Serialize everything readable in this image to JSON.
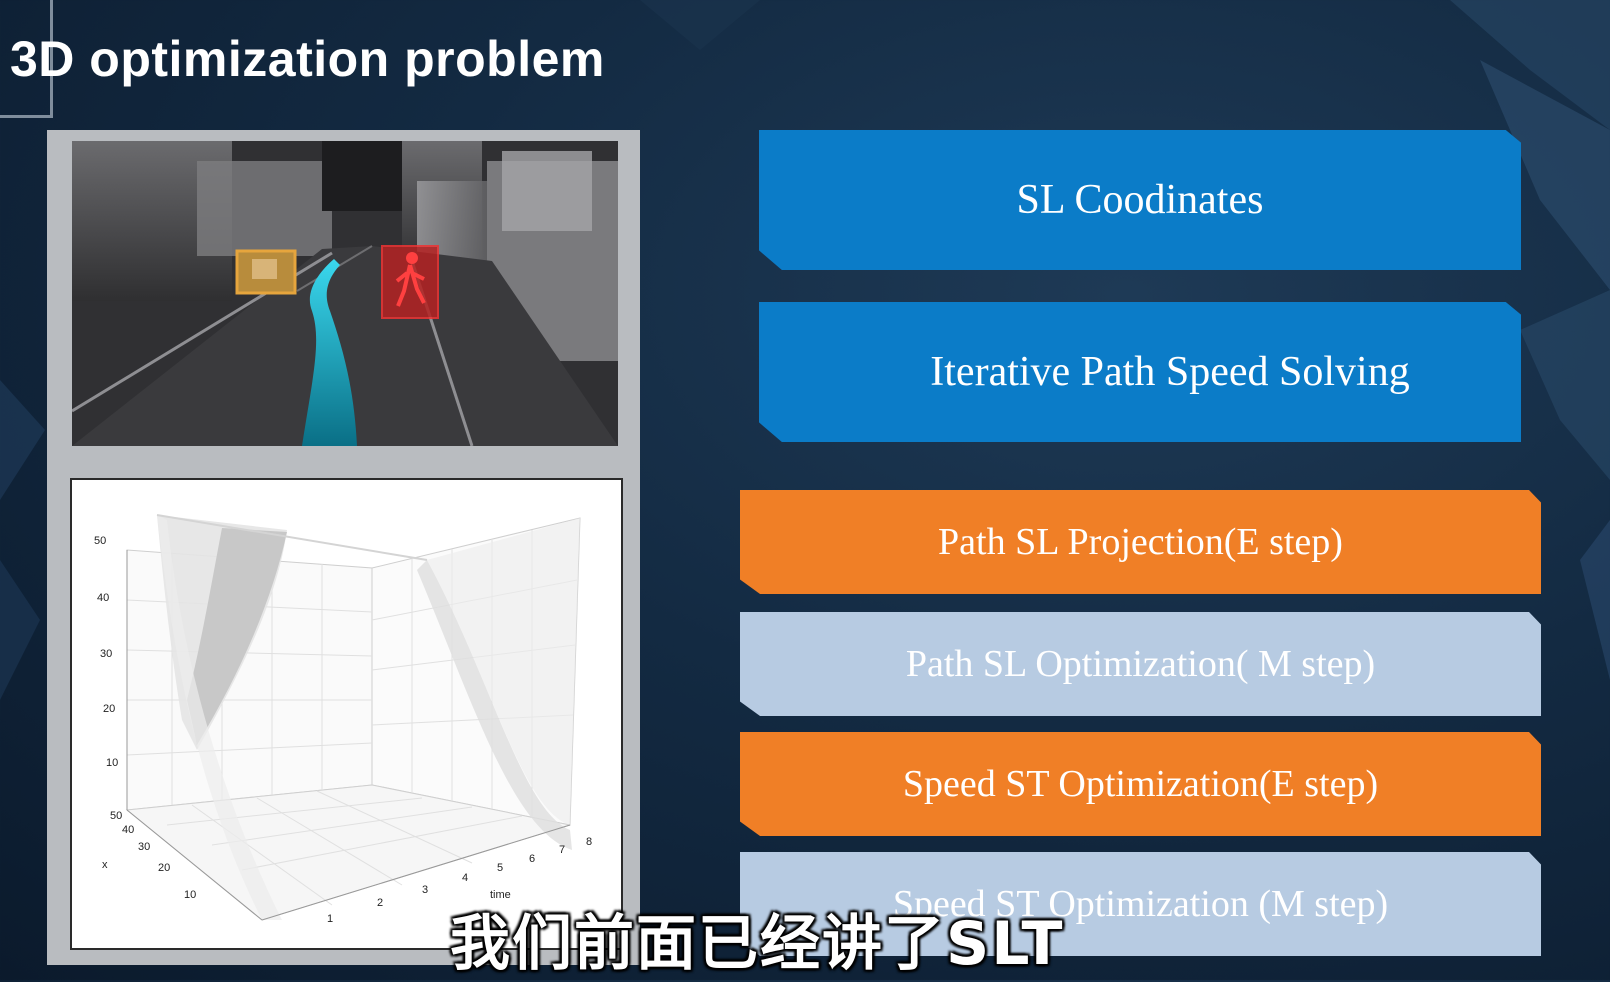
{
  "title": "3D optimization problem",
  "steps": {
    "sl_coordinates": "SL Coodinates",
    "iterative": "Iterative Path Speed Solving",
    "path_sl_projection": "Path SL Projection(E step)",
    "path_sl_optimization": "Path SL Optimization( M step)",
    "speed_st_optimization_e": "Speed ST Optimization(E step)",
    "speed_st_optimization_m": "Speed ST Optimization (M step)"
  },
  "plot": {
    "z_ticks": [
      "50",
      "40",
      "30",
      "20",
      "10",
      "50"
    ],
    "x_ticks": [
      "40",
      "30",
      "20",
      "10"
    ],
    "x_label": "x",
    "time_ticks": [
      "1",
      "2",
      "3",
      "4",
      "5",
      "6",
      "7",
      "8"
    ],
    "time_label": "time"
  },
  "subtitle": "我们前面已经讲了SLT",
  "colors": {
    "blue": "#0b7cc8",
    "orange": "#f07f26",
    "pale_blue": "#b7cbe2"
  }
}
